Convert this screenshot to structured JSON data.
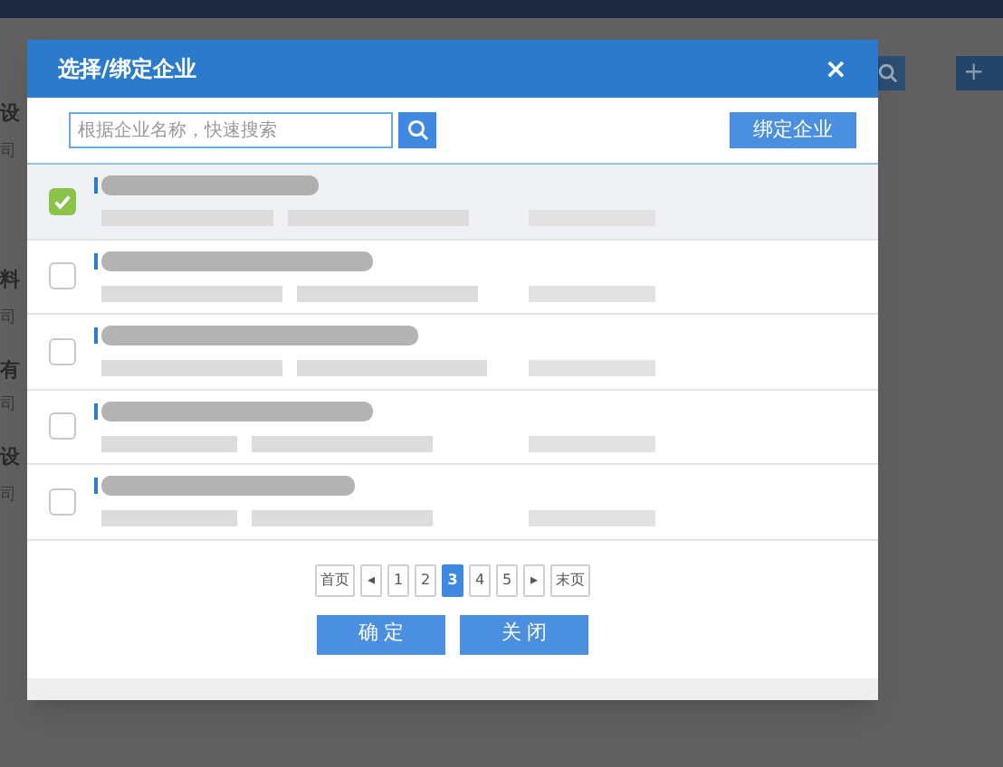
{
  "background_page": {
    "labels": [
      "设",
      "司",
      "料",
      "司",
      "有",
      "司",
      "设",
      "司"
    ],
    "add_button": "+"
  },
  "dialog": {
    "title": "选择/绑定企业",
    "close": "×",
    "search": {
      "placeholder": "根据企业名称，快速搜索"
    },
    "bind_button": "绑定企业",
    "rows": [
      {
        "checked": true,
        "selected": true
      },
      {
        "checked": false,
        "selected": false
      },
      {
        "checked": false,
        "selected": false
      },
      {
        "checked": false,
        "selected": false
      },
      {
        "checked": false,
        "selected": false
      }
    ],
    "pagination": [
      {
        "label": "首页",
        "selected": false
      },
      {
        "label": "◂",
        "selected": false
      },
      {
        "label": "1",
        "selected": false
      },
      {
        "label": "2",
        "selected": false
      },
      {
        "label": "3",
        "selected": true
      },
      {
        "label": "4",
        "selected": false
      },
      {
        "label": "5",
        "selected": false
      },
      {
        "label": "▸",
        "selected": false
      },
      {
        "label": "末页",
        "selected": false
      }
    ],
    "buttons": [
      "确 定",
      "关 闭"
    ]
  }
}
